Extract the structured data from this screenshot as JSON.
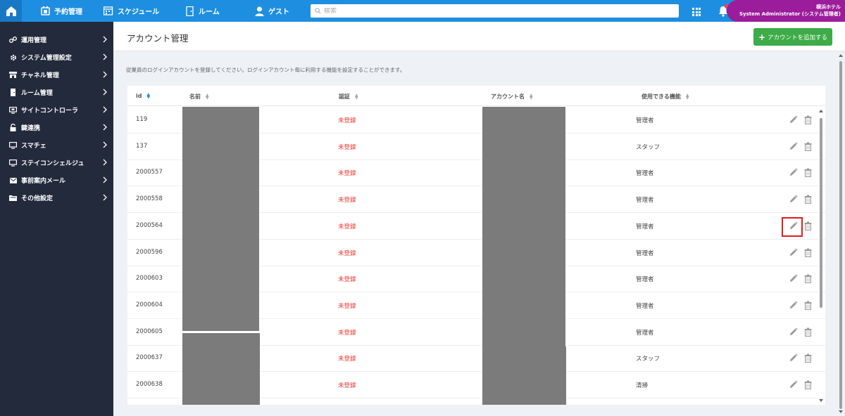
{
  "topbar": {
    "nav": [
      {
        "label": "予約管理",
        "icon": "calendar-icon"
      },
      {
        "label": "スケジュール",
        "icon": "schedule-icon"
      },
      {
        "label": "ルーム",
        "icon": "room-icon"
      },
      {
        "label": "ゲスト",
        "icon": "guest-icon"
      }
    ],
    "search_placeholder": "検索",
    "user_line1": "横浜ホテル",
    "user_line2": "System Administrator (システム管理者)"
  },
  "sidebar": {
    "items": [
      {
        "label": "運用管理",
        "icon": "operations-icon"
      },
      {
        "label": "システム管理設定",
        "icon": "gear-icon"
      },
      {
        "label": "チャネル管理",
        "icon": "channel-icon"
      },
      {
        "label": "ルーム管理",
        "icon": "room-icon"
      },
      {
        "label": "サイトコントローラ",
        "icon": "site-controller-icon"
      },
      {
        "label": "鍵連携",
        "icon": "lock-icon"
      },
      {
        "label": "スマチェ",
        "icon": "monitor-icon"
      },
      {
        "label": "ステイコンシェルジュ",
        "icon": "monitor-icon"
      },
      {
        "label": "事前案内メール",
        "icon": "mail-icon"
      },
      {
        "label": "その他設定",
        "icon": "folder-icon"
      }
    ]
  },
  "page": {
    "title": "アカウント管理",
    "add_button": "アカウントを追加する",
    "description": "従業員のログインアカウントを登録してください。ログインアカウント毎に利用する機能を設定することができます。"
  },
  "table": {
    "columns": [
      "id",
      "名前",
      "認証",
      "アカウント名",
      "使用できる機能"
    ],
    "rows": [
      {
        "id": "119",
        "auth": "未登録",
        "feature": "管理者"
      },
      {
        "id": "137",
        "auth": "未登録",
        "feature": "スタッフ"
      },
      {
        "id": "2000557",
        "auth": "未登録",
        "feature": "管理者"
      },
      {
        "id": "2000558",
        "auth": "未登録",
        "feature": "管理者"
      },
      {
        "id": "2000564",
        "auth": "未登録",
        "feature": "管理者"
      },
      {
        "id": "2000596",
        "auth": "未登録",
        "feature": "管理者"
      },
      {
        "id": "2000603",
        "auth": "未登録",
        "feature": "管理者"
      },
      {
        "id": "2000604",
        "auth": "未登録",
        "feature": "管理者"
      },
      {
        "id": "2000605",
        "auth": "未登録",
        "feature": "管理者"
      },
      {
        "id": "2000637",
        "auth": "未登録",
        "feature": "スタッフ"
      },
      {
        "id": "2000638",
        "auth": "未登録",
        "feature": "清掃"
      }
    ]
  },
  "colors": {
    "topbar": "#1e8fe0",
    "sidebar": "#232a3b",
    "add_button": "#3dab48",
    "unregistered": "#e8332a",
    "user_badge": "#9b1d9b"
  }
}
